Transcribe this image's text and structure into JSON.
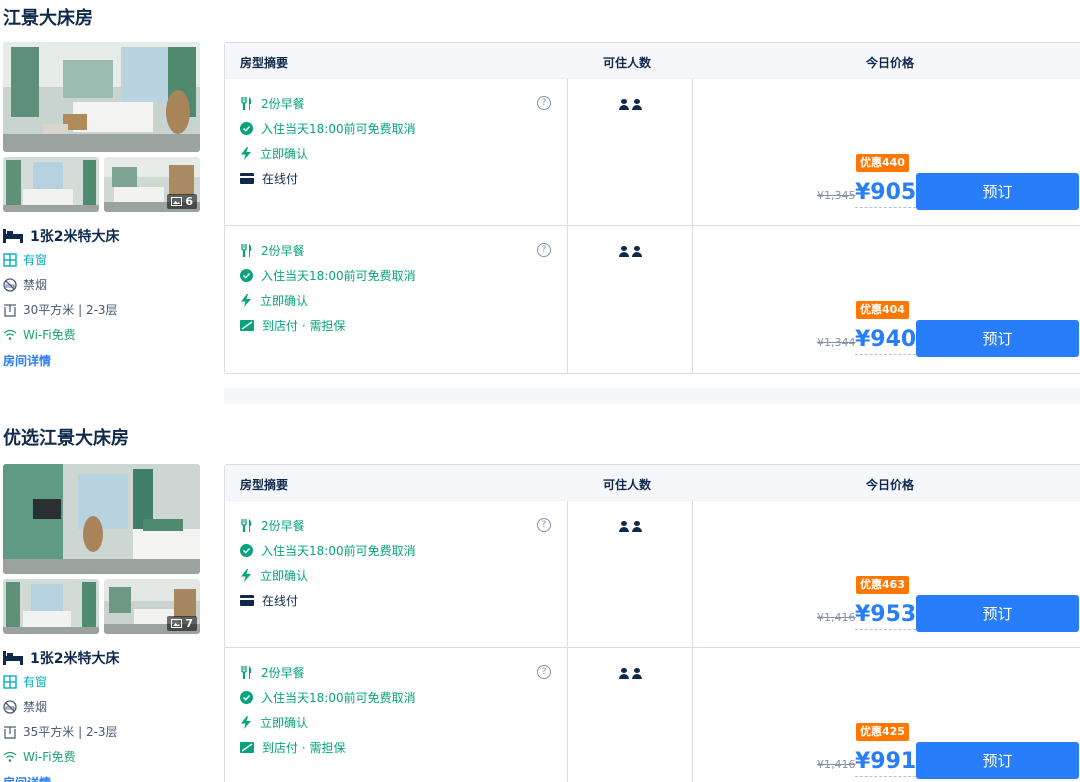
{
  "table_headers": {
    "summary": "房型摘要",
    "guests": "可住人数",
    "price": "今日价格"
  },
  "help_icon_label": "?",
  "book_label": "预订",
  "rooms": [
    {
      "title": "江景大床房",
      "photo_count": "6",
      "bed": "1张2米特大床",
      "window": "有窗",
      "smoking": "禁烟",
      "area": "30平方米 | 2-3层",
      "wifi": "Wi-Fi免费",
      "detail_link": "房间详情",
      "plans": [
        {
          "breakfast": "2份早餐",
          "cancel": "入住当天18:00前可免费取消",
          "confirm": "立即确认",
          "payment": "在线付",
          "payment_icon": "card-icon",
          "discount": "优惠440",
          "original_price": "¥1,345",
          "price": "¥905"
        },
        {
          "breakfast": "2份早餐",
          "cancel": "入住当天18:00前可免费取消",
          "confirm": "立即确认",
          "payment": "到店付 · 需担保",
          "payment_icon": "pay-at-hotel-icon",
          "discount": "优惠404",
          "original_price": "¥1,344",
          "price": "¥940"
        }
      ]
    },
    {
      "title": "优选江景大床房",
      "photo_count": "7",
      "bed": "1张2米特大床",
      "window": "有窗",
      "smoking": "禁烟",
      "area": "35平方米 | 2-3层",
      "wifi": "Wi-Fi免费",
      "detail_link": "房间详情",
      "plans": [
        {
          "breakfast": "2份早餐",
          "cancel": "入住当天18:00前可免费取消",
          "confirm": "立即确认",
          "payment": "在线付",
          "payment_icon": "card-icon",
          "discount": "优惠463",
          "original_price": "¥1,416",
          "price": "¥953"
        },
        {
          "breakfast": "2份早餐",
          "cancel": "入住当天18:00前可免费取消",
          "confirm": "立即确认",
          "payment": "到店付 · 需担保",
          "payment_icon": "pay-at-hotel-icon",
          "discount": "优惠425",
          "original_price": "¥1,416",
          "price": "¥991"
        }
      ]
    }
  ]
}
